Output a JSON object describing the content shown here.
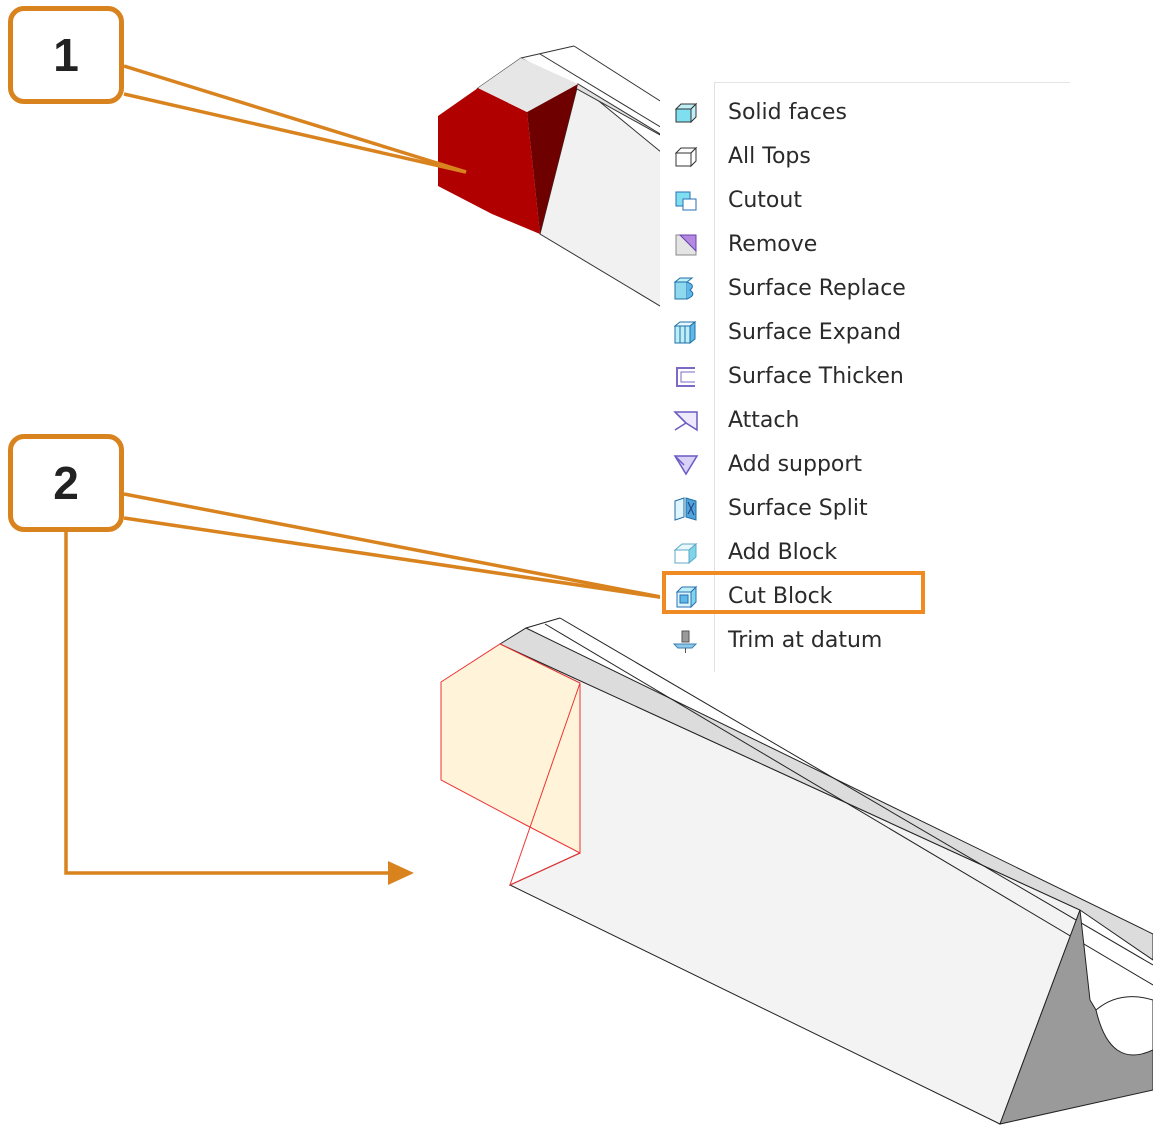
{
  "callouts": [
    {
      "number": "1"
    },
    {
      "number": "2"
    }
  ],
  "menu": {
    "items": [
      {
        "label": "Solid faces",
        "icon": "solid-faces-icon"
      },
      {
        "label": "All Tops",
        "icon": "all-tops-icon"
      },
      {
        "label": "Cutout",
        "icon": "cutout-icon"
      },
      {
        "label": "Remove",
        "icon": "remove-icon"
      },
      {
        "label": "Surface Replace",
        "icon": "surface-replace-icon"
      },
      {
        "label": "Surface Expand",
        "icon": "surface-expand-icon"
      },
      {
        "label": "Surface Thicken",
        "icon": "surface-thicken-icon"
      },
      {
        "label": "Attach",
        "icon": "attach-icon"
      },
      {
        "label": "Add support",
        "icon": "add-support-icon"
      },
      {
        "label": "Surface Split",
        "icon": "surface-split-icon"
      },
      {
        "label": "Add Block",
        "icon": "add-block-icon"
      },
      {
        "label": "Cut Block",
        "icon": "cut-block-icon"
      },
      {
        "label": "Trim at datum",
        "icon": "trim-at-datum-icon"
      }
    ],
    "highlighted_item": "Cut Block"
  },
  "colors": {
    "callout_accent": "#d9831f",
    "highlight_border": "#f08a22",
    "selected_face": "#b00000",
    "selected_face_dark": "#6e0000",
    "cut_block_fill": "#fff3da",
    "cut_block_edge": "#ee3333"
  }
}
